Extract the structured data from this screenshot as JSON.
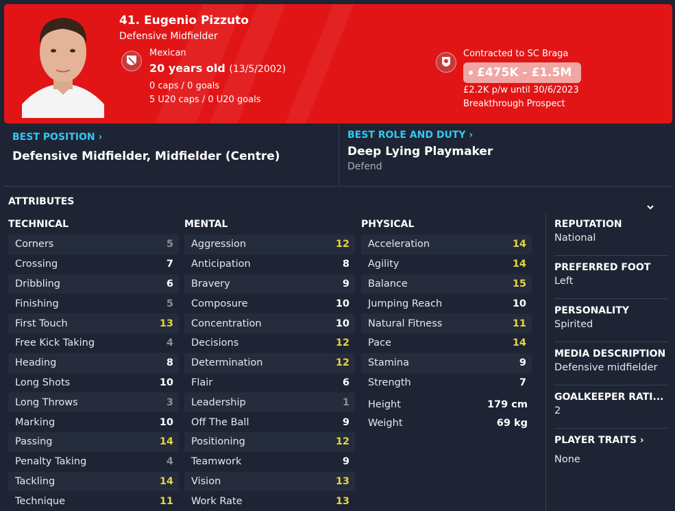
{
  "colors": {
    "header_red": "#e21516",
    "accent_blue": "#33c8f5",
    "highlight_yellow": "#e5d442",
    "panel": "#1e2433"
  },
  "player": {
    "name": "41. Eugenio Pizzuto",
    "position": "Defensive Midfielder",
    "nationality": "Mexican",
    "age": "20 years old",
    "dob": "(13/5/2002)",
    "caps": "0 caps / 0 goals",
    "u20_caps": "5 U20 caps / 0 U20 goals",
    "contract": "Contracted to SC Braga",
    "value": "£475K - £1.5M",
    "wage": "£2.2K p/w until 30/6/2023",
    "status": "Breakthrough Prospect"
  },
  "best_position": {
    "label": "BEST POSITION",
    "value": "Defensive Midfielder, Midfielder (Centre)"
  },
  "best_role": {
    "label": "BEST ROLE AND DUTY",
    "role": "Deep Lying Playmaker",
    "duty": "Defend"
  },
  "attributes_title": "ATTRIBUTES",
  "technical": {
    "title": "TECHNICAL",
    "rows": [
      {
        "name": "Corners",
        "value": "5"
      },
      {
        "name": "Crossing",
        "value": "7"
      },
      {
        "name": "Dribbling",
        "value": "6"
      },
      {
        "name": "Finishing",
        "value": "5"
      },
      {
        "name": "First Touch",
        "value": "13"
      },
      {
        "name": "Free Kick Taking",
        "value": "4"
      },
      {
        "name": "Heading",
        "value": "8"
      },
      {
        "name": "Long Shots",
        "value": "10"
      },
      {
        "name": "Long Throws",
        "value": "3"
      },
      {
        "name": "Marking",
        "value": "10"
      },
      {
        "name": "Passing",
        "value": "14"
      },
      {
        "name": "Penalty Taking",
        "value": "4"
      },
      {
        "name": "Tackling",
        "value": "14"
      },
      {
        "name": "Technique",
        "value": "11"
      }
    ]
  },
  "mental": {
    "title": "MENTAL",
    "rows": [
      {
        "name": "Aggression",
        "value": "12"
      },
      {
        "name": "Anticipation",
        "value": "8"
      },
      {
        "name": "Bravery",
        "value": "9"
      },
      {
        "name": "Composure",
        "value": "10"
      },
      {
        "name": "Concentration",
        "value": "10"
      },
      {
        "name": "Decisions",
        "value": "12"
      },
      {
        "name": "Determination",
        "value": "12"
      },
      {
        "name": "Flair",
        "value": "6"
      },
      {
        "name": "Leadership",
        "value": "1"
      },
      {
        "name": "Off The Ball",
        "value": "9"
      },
      {
        "name": "Positioning",
        "value": "12"
      },
      {
        "name": "Teamwork",
        "value": "9"
      },
      {
        "name": "Vision",
        "value": "13"
      },
      {
        "name": "Work Rate",
        "value": "13"
      }
    ]
  },
  "physical": {
    "title": "PHYSICAL",
    "rows": [
      {
        "name": "Acceleration",
        "value": "14"
      },
      {
        "name": "Agility",
        "value": "14"
      },
      {
        "name": "Balance",
        "value": "15"
      },
      {
        "name": "Jumping Reach",
        "value": "10"
      },
      {
        "name": "Natural Fitness",
        "value": "11"
      },
      {
        "name": "Pace",
        "value": "14"
      },
      {
        "name": "Stamina",
        "value": "9"
      },
      {
        "name": "Strength",
        "value": "7"
      }
    ],
    "height_label": "Height",
    "height": "179 cm",
    "weight_label": "Weight",
    "weight": "69 kg"
  },
  "sidebar": {
    "reputation_label": "REPUTATION",
    "reputation": "National",
    "foot_label": "PREFERRED FOOT",
    "foot": "Left",
    "personality_label": "PERSONALITY",
    "personality": "Spirited",
    "media_label": "MEDIA DESCRIPTION",
    "media": "Defensive midfielder",
    "gk_label": "GOALKEEPER RATI...",
    "gk": "2",
    "traits_label": "PLAYER TRAITS",
    "traits": "None"
  }
}
